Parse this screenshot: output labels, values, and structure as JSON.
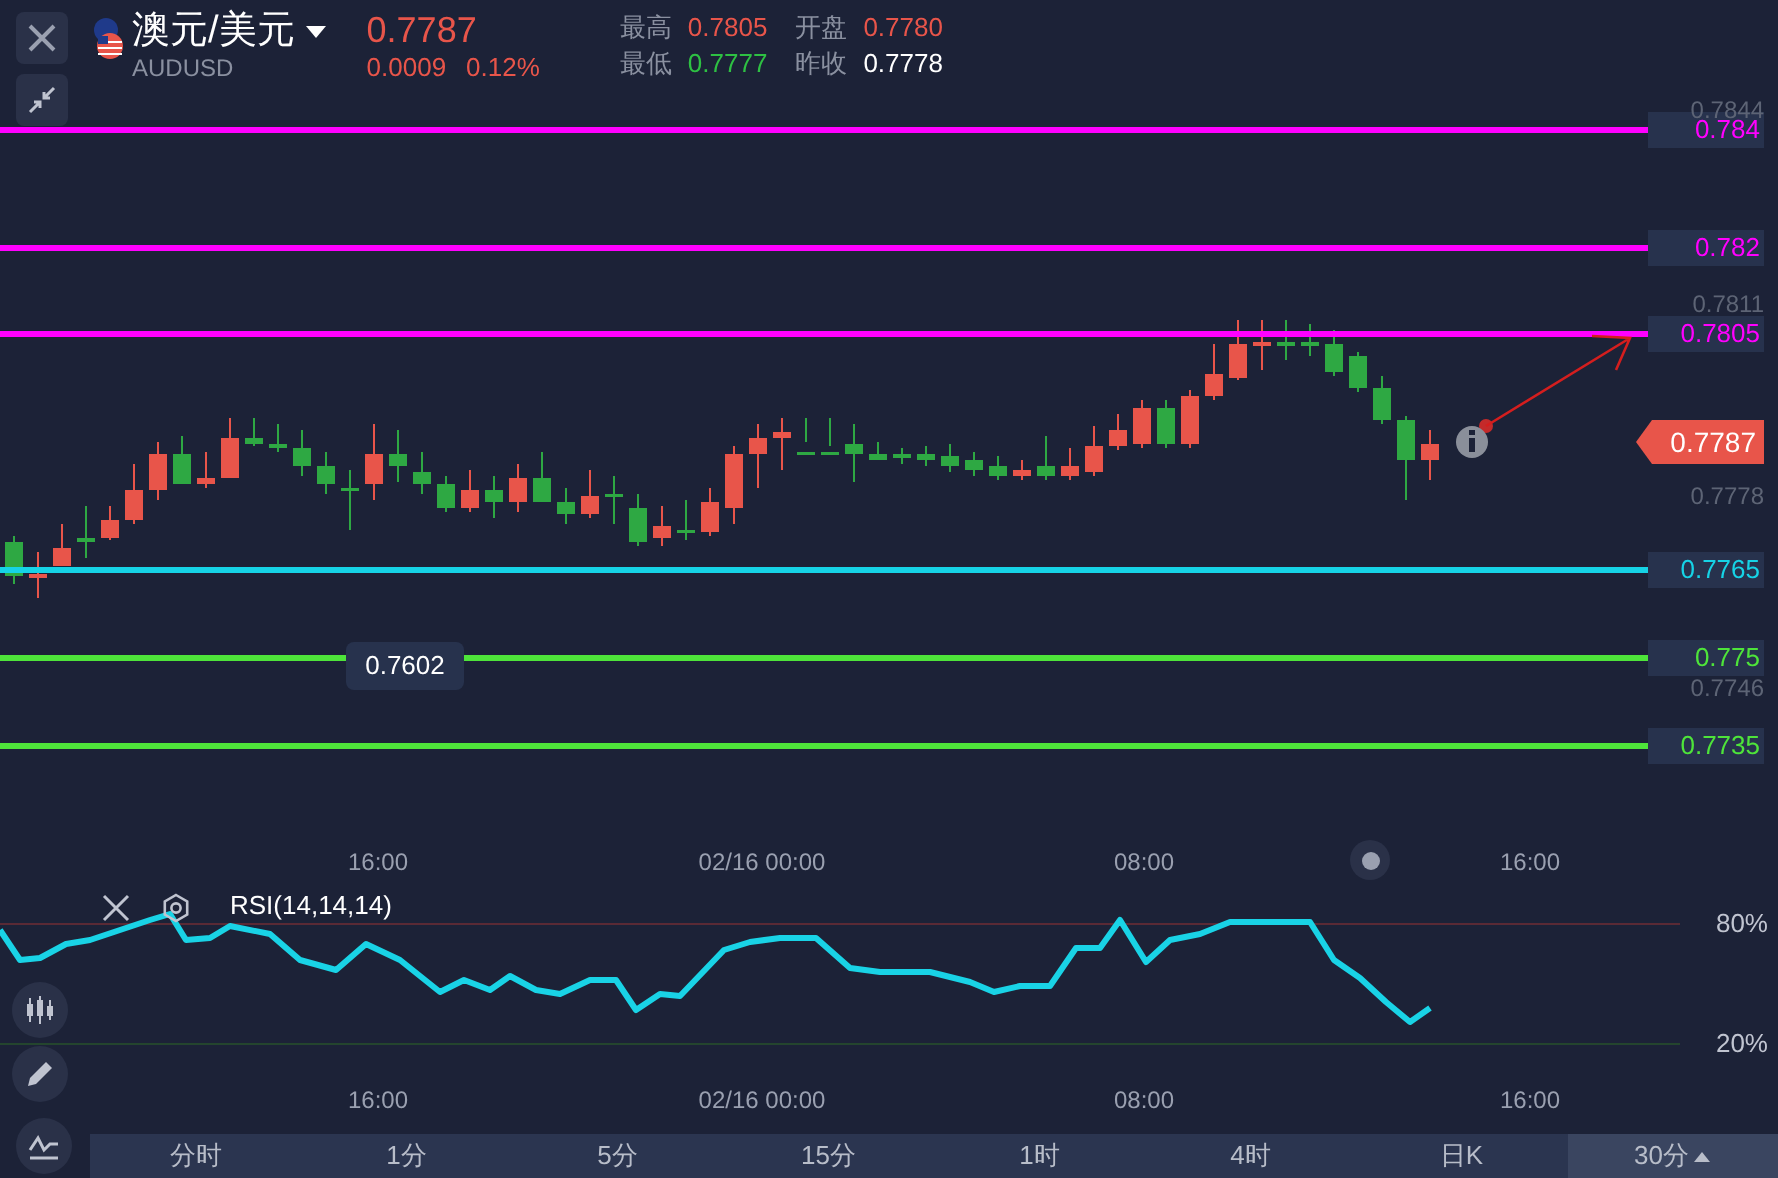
{
  "header": {
    "pair": "澳元/美元",
    "symbol": "AUDUSD",
    "price": "0.7787",
    "change": "0.0009",
    "change_pct": "0.12%",
    "stats": [
      {
        "label": "最高",
        "value": "0.7805",
        "kind": "up"
      },
      {
        "label": "开盘",
        "value": "0.7780",
        "kind": "up"
      },
      {
        "label": "最低",
        "value": "0.7777",
        "kind": "down"
      },
      {
        "label": "昨收",
        "value": "0.7778",
        "kind": "flat"
      }
    ]
  },
  "lines": [
    {
      "label": "0.784",
      "color": "#ff00ff"
    },
    {
      "label": "0.782",
      "color": "#ff00ff"
    },
    {
      "label": "0.7805",
      "color": "#ff00ff"
    },
    {
      "label": "0.7765",
      "color": "#16d3e6"
    },
    {
      "label": "0.775",
      "color": "#4ee43a"
    },
    {
      "label": "0.7735",
      "color": "#4ee43a"
    }
  ],
  "price_axis": [
    "0.7844",
    "0.7811",
    "0.7778",
    "0.7746"
  ],
  "current_price_tag": "0.7787",
  "crosshair_tooltip": "0.7602",
  "time_axis": [
    "16:00",
    "02/16 00:00",
    "08:00",
    "16:00"
  ],
  "rsi": {
    "label": "RSI(14,14,14)",
    "levels": [
      "80%",
      "20%"
    ],
    "time_axis": [
      "16:00",
      "02/16 00:00",
      "08:00",
      "16:00"
    ]
  },
  "timeframe_tabs": [
    {
      "label": "分时",
      "selected": false
    },
    {
      "label": "1分",
      "selected": false
    },
    {
      "label": "5分",
      "selected": false
    },
    {
      "label": "15分",
      "selected": false
    },
    {
      "label": "1时",
      "selected": false
    },
    {
      "label": "4时",
      "selected": false
    },
    {
      "label": "日K",
      "selected": false
    },
    {
      "label": "30分",
      "selected": true
    }
  ]
}
